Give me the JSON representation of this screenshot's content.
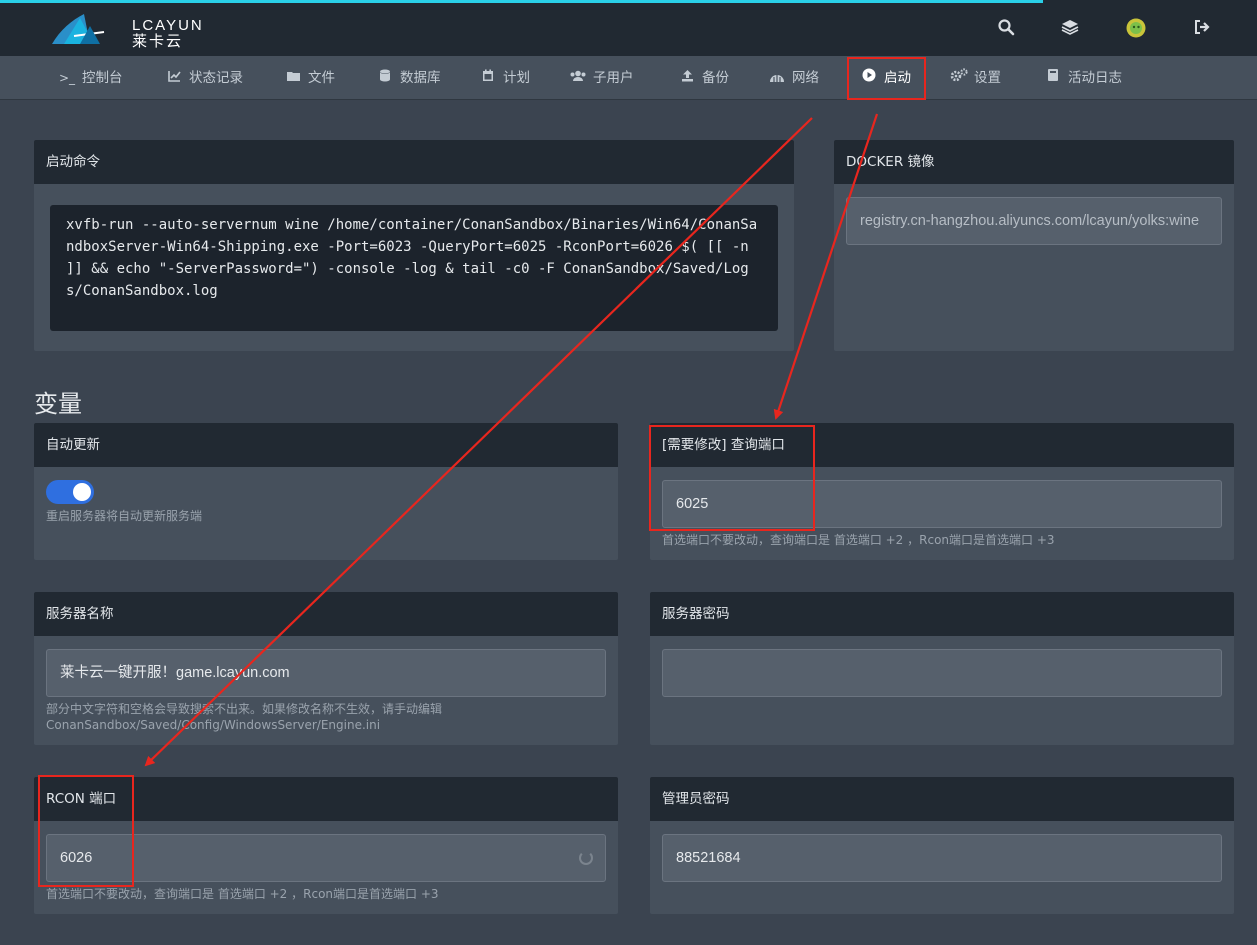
{
  "header": {
    "brand_top": "LCAYUN",
    "brand_bottom": "莱卡云",
    "icons": [
      "search-icon",
      "layers-icon",
      "avatar",
      "logout-icon"
    ]
  },
  "nav": {
    "items": [
      {
        "label": "控制台",
        "icon": "terminal-icon"
      },
      {
        "label": "状态记录",
        "icon": "chart-icon"
      },
      {
        "label": "文件",
        "icon": "folder-icon"
      },
      {
        "label": "数据库",
        "icon": "database-icon"
      },
      {
        "label": "计划",
        "icon": "calendar-icon"
      },
      {
        "label": "子用户",
        "icon": "users-icon"
      },
      {
        "label": "备份",
        "icon": "upload-icon"
      },
      {
        "label": "网络",
        "icon": "network-icon"
      },
      {
        "label": "启动",
        "icon": "play-icon",
        "active": true
      },
      {
        "label": "设置",
        "icon": "gears-icon"
      },
      {
        "label": "活动日志",
        "icon": "book-icon"
      }
    ]
  },
  "startup": {
    "command_title": "启动命令",
    "command": "xvfb-run --auto-servernum wine /home/container/ConanSandbox/Binaries/Win64/ConanSandboxServer-Win64-Shipping.exe -Port=6023 -QueryPort=6025 -RconPort=6026 $( [[ -n ]] && echo \"-ServerPassword=\") -console -log & tail -c0 -F ConanSandbox/Saved/Logs/ConanSandbox.log",
    "docker_title": "DOCKER 镜像",
    "docker_image": "registry.cn-hangzhou.aliyuncs.com/lcayun/yolks:wine"
  },
  "variables": {
    "section_title": "变量",
    "auto_update": {
      "title": "自动更新",
      "enabled": true,
      "description": "重启服务器将自动更新服务端"
    },
    "query_port": {
      "title": "[需要修改] 查询端口",
      "value": "6025",
      "description": "首选端口不要改动，查询端口是 首选端口 +2 ，Rcon端口是首选端口 +3"
    },
    "server_name": {
      "title": "服务器名称",
      "value": "莱卡云一键开服！game.lcayun.com",
      "description": "部分中文字符和空格会导致搜索不出来。如果修改名称不生效，请手动编辑 ConanSandbox/Saved/Config/WindowsServer/Engine.ini"
    },
    "server_password": {
      "title": "服务器密码",
      "value": ""
    },
    "rcon_port": {
      "title": "RCON 端口",
      "value": "6026",
      "description": "首选端口不要改动，查询端口是 首选端口 +2 ，Rcon端口是首选端口 +3"
    },
    "admin_password": {
      "title": "管理员密码",
      "value": "88521684"
    }
  },
  "colors": {
    "accent": "#2ad0e8",
    "highlight": "#e8261e",
    "toggle_on": "#2f6fe0"
  }
}
